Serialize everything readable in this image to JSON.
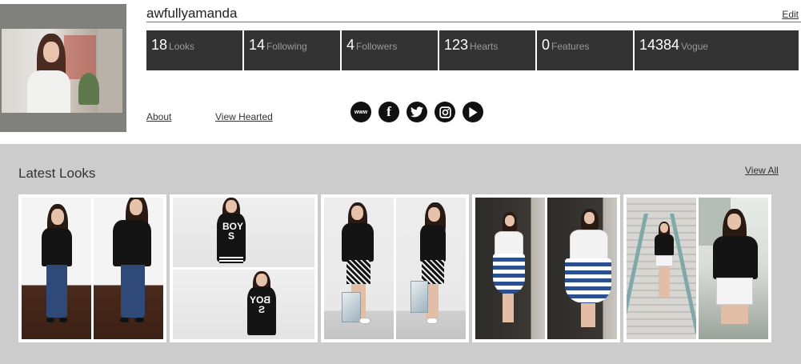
{
  "profile": {
    "username": "awfullyamanda",
    "edit_label": "Edit"
  },
  "stats": [
    {
      "value": "18",
      "label": "Looks"
    },
    {
      "value": "14",
      "label": "Following"
    },
    {
      "value": "4",
      "label": "Followers"
    },
    {
      "value": "123",
      "label": "Hearts"
    },
    {
      "value": "0",
      "label": "Features"
    },
    {
      "value": "14384",
      "label": "Vogue"
    }
  ],
  "links": {
    "about": "About",
    "view_hearted": "View Hearted"
  },
  "socials": [
    {
      "icon": "www-icon",
      "glyph": "www"
    },
    {
      "icon": "facebook-icon",
      "glyph": "f"
    },
    {
      "icon": "twitter-icon"
    },
    {
      "icon": "instagram-icon"
    },
    {
      "icon": "youtube-icon"
    }
  ],
  "latest_looks": {
    "title": "Latest Looks",
    "view_all": "View All",
    "tee_print": "BOY S"
  },
  "colors": {
    "stat_background": "#333333",
    "stat_label": "#9a9a9a",
    "looks_panel_background": "#cccccc",
    "avatar_frame": "#80807c"
  }
}
